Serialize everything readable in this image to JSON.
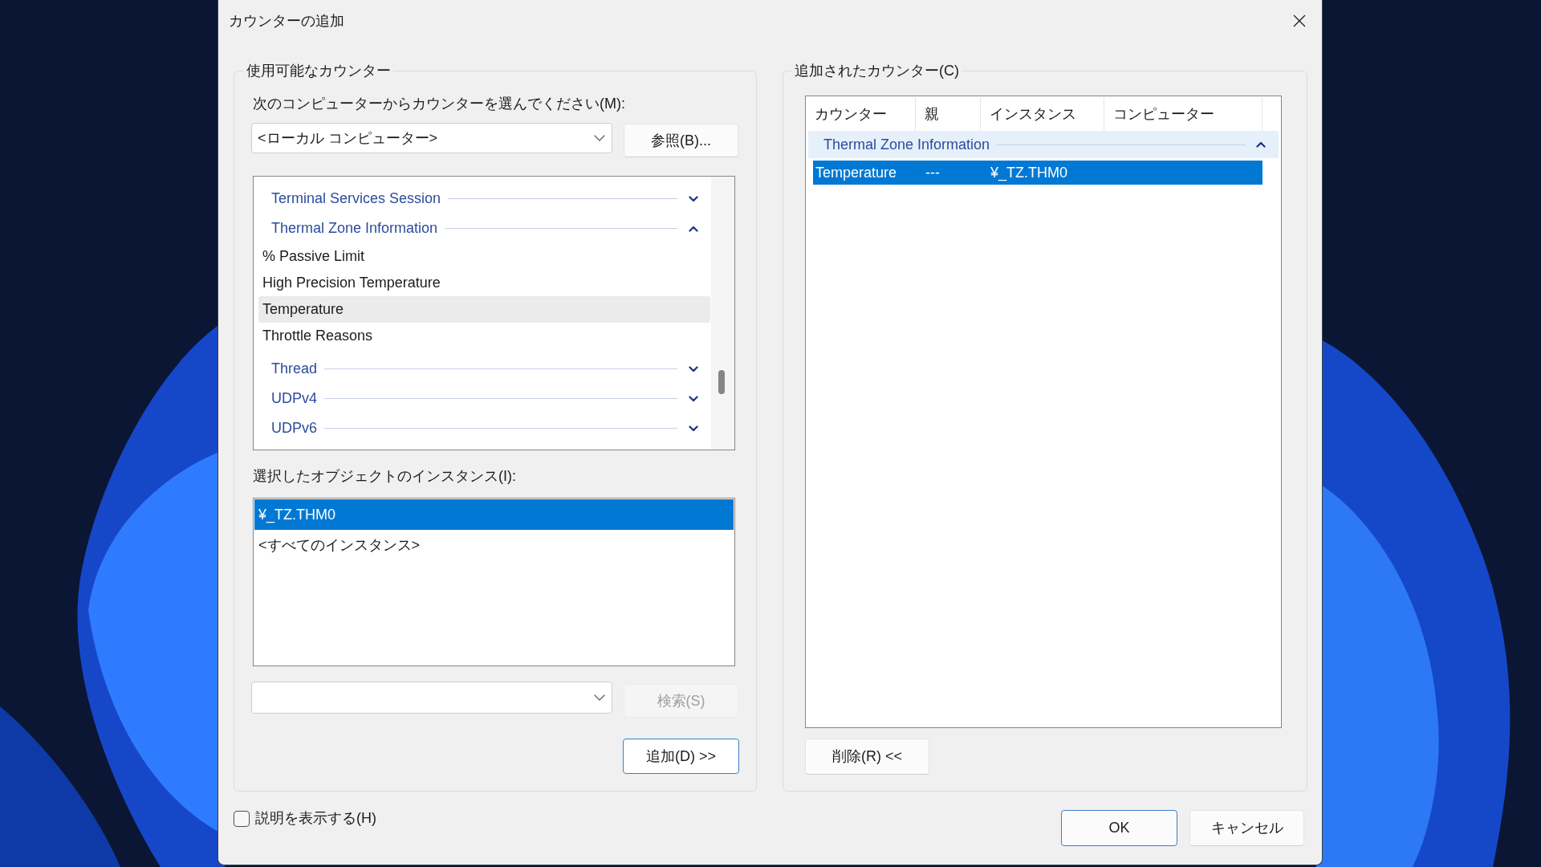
{
  "window": {
    "title": "カウンターの追加"
  },
  "available_counters": {
    "title": "使用可能なカウンター",
    "computer_label": "次のコンピューターからカウンターを選んでください(M):",
    "computer_dropdown": {
      "value": "<ローカル コンピューター>"
    },
    "browse_button": "参照(B)...",
    "counters": [
      {
        "label": "Terminal Services Session",
        "expanded": false
      },
      {
        "label": "Thermal Zone Information",
        "expanded": true,
        "children": [
          {
            "label": "% Passive Limit",
            "selected": false
          },
          {
            "label": "High Precision Temperature",
            "selected": false
          },
          {
            "label": "Temperature",
            "selected": true
          },
          {
            "label": "Throttle Reasons",
            "selected": false
          }
        ]
      },
      {
        "label": "Thread",
        "expanded": false
      },
      {
        "label": "UDPv4",
        "expanded": false
      },
      {
        "label": "UDPv6",
        "expanded": false
      }
    ],
    "instances_label": "選択したオブジェクトのインスタンス(I):",
    "instances": [
      {
        "label": "¥_TZ.THM0",
        "selected": true
      },
      {
        "label": "<すべてのインスタンス>",
        "selected": false
      }
    ],
    "search_button": {
      "label": "検索(S)",
      "disabled": true
    },
    "add_button": {
      "label": "追加(D) >>",
      "focused": true
    }
  },
  "added_counters": {
    "title": "追加されたカウンター(C)",
    "columns": [
      "カウンター",
      "親",
      "インスタンス",
      "コンピューター"
    ],
    "groups": [
      {
        "label": "Thermal Zone Information",
        "expanded": true,
        "rows": [
          {
            "cells": [
              "Temperature",
              "---",
              "¥_TZ.THM0"
            ],
            "selected": true
          }
        ]
      }
    ],
    "remove_button": "削除(R) <<"
  },
  "show_description": {
    "label": "説明を表示する(H)",
    "checked": false
  },
  "buttons": [
    {
      "label": "OK",
      "default": true
    },
    {
      "label": "キャンセル",
      "default": false
    }
  ]
}
